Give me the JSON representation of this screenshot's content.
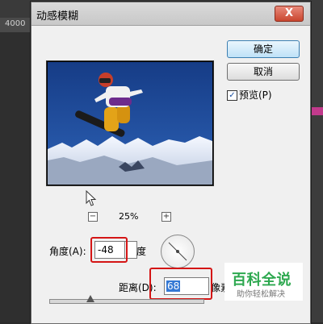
{
  "background": {
    "ruler_label": "4000"
  },
  "dialog": {
    "title": "动感模糊",
    "close_symbol": "X",
    "buttons": {
      "ok_label": "确定",
      "cancel_label": "取消"
    },
    "preview_checkbox": {
      "label": "预览(P)",
      "checked": true
    },
    "zoom": {
      "minus_symbol": "−",
      "value": "25%",
      "plus_symbol": "+"
    },
    "angle": {
      "label": "角度(A):",
      "value": "-48",
      "unit_label": "度"
    },
    "distance": {
      "label": "距离(D):",
      "value": "68",
      "unit_label": "像素"
    },
    "distance_slider_fraction": 0.27
  },
  "watermark": {
    "title": "百科全说",
    "subtitle": "助你轻松解决",
    "color": "#2da84f"
  }
}
